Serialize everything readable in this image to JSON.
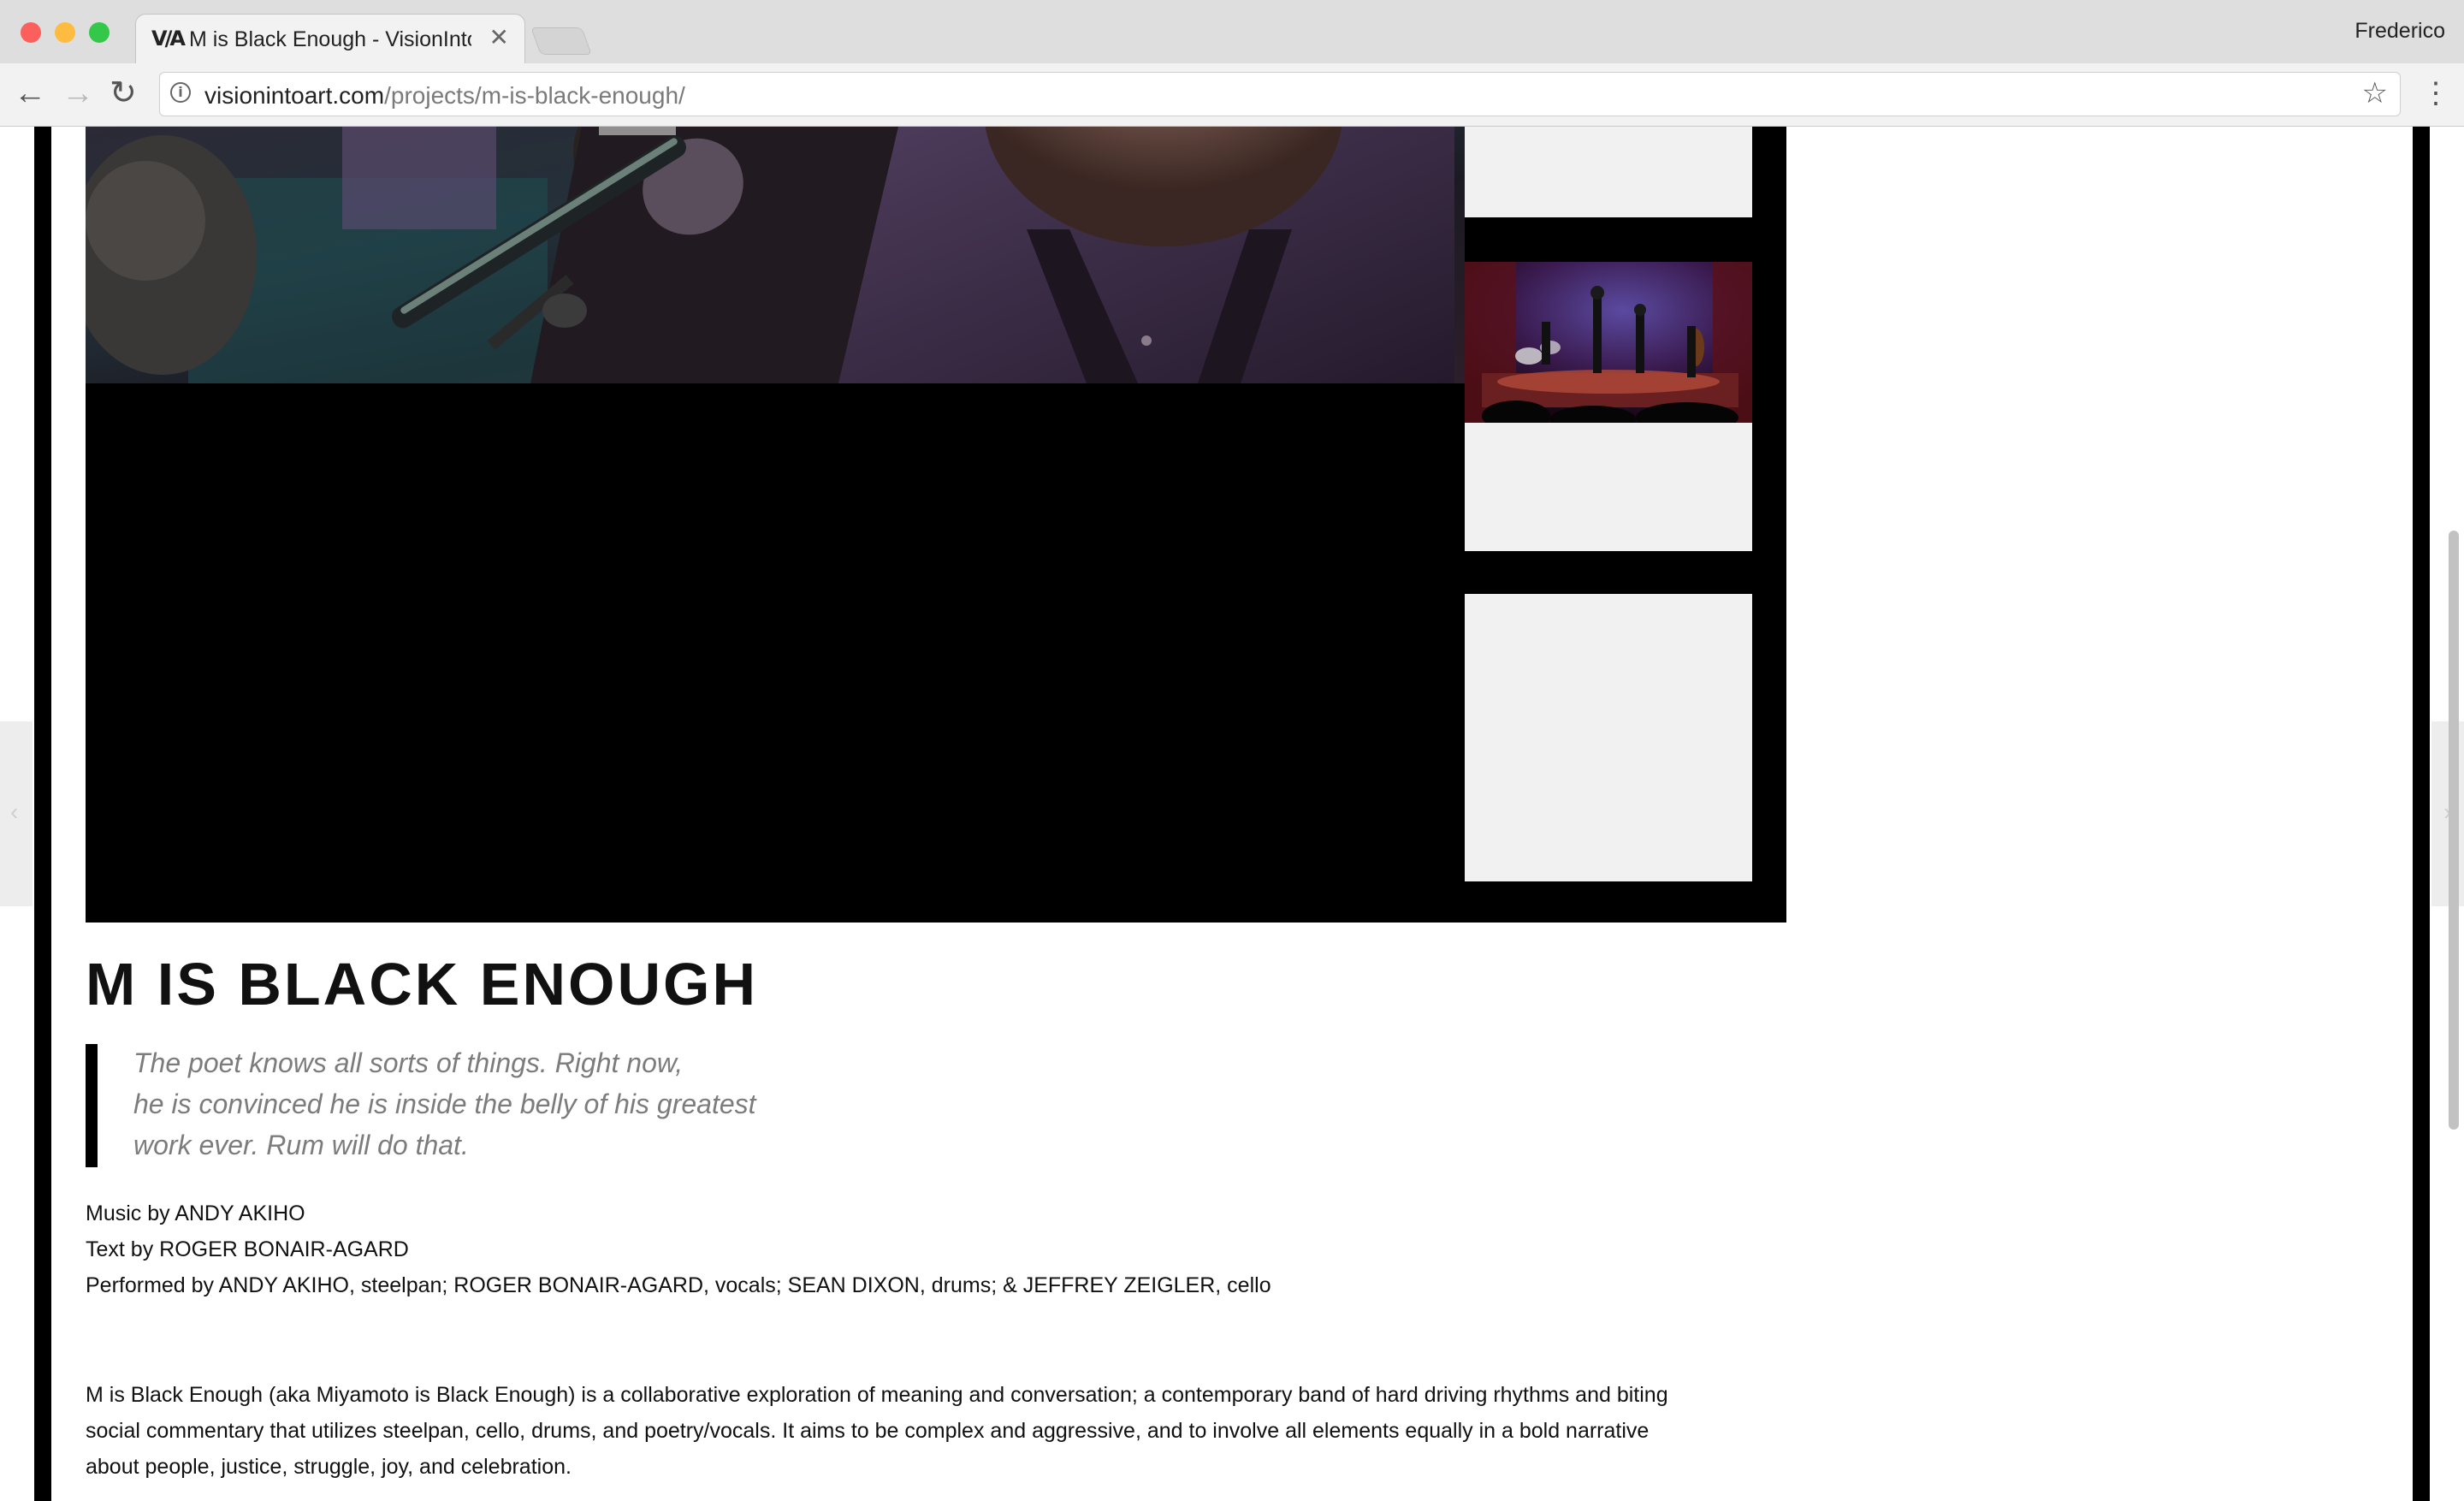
{
  "browser": {
    "tab_title": "M is Black Enough - VisionIntoArt",
    "favicon_text": "V/A",
    "profile_name": "Frederico",
    "url_host": "visionintoart.com",
    "url_path": "/projects/m-is-black-enough/",
    "tab_close_glyph": "✕",
    "back_glyph": "←",
    "forward_glyph": "→",
    "reload_glyph": "↻",
    "star_glyph": "☆",
    "menu_glyph": "⋮",
    "info_glyph": "i"
  },
  "project": {
    "title": "M IS BLACK ENOUGH",
    "quote_lines": [
      "The poet knows all sorts of things. Right now,",
      "he is convinced he is inside the belly of his greatest",
      "work ever. Rum will do that."
    ],
    "credits": [
      "Music by ANDY AKIHO",
      "Text by ROGER BONAIR-AGARD",
      "Performed by ANDY AKIHO, steelpan; ROGER BONAIR-AGARD, vocals; SEAN DIXON, drums; & JEFFREY ZEIGLER, cello"
    ],
    "description_lines": [
      "M is Black Enough (aka Miyamoto is Black Enough) is a collaborative exploration of meaning and conversation; a contemporary band of hard driving rhythms and biting",
      "social commentary that utilizes steelpan, cello, drums, and poetry/vocals. It aims to be complex and aggressive, and to involve all elements equally in a bold narrative",
      "about people, justice, struggle, joy, and celebration."
    ]
  },
  "nav_arrows": {
    "prev": "‹",
    "next": "›"
  },
  "colors": {
    "frame": "#000000",
    "thumb_blank": "#f1f1f1",
    "quote_text": "#7c7c7c",
    "traffic_red": "#fc605c",
    "traffic_yellow": "#fdbc40",
    "traffic_green": "#34c84a"
  }
}
